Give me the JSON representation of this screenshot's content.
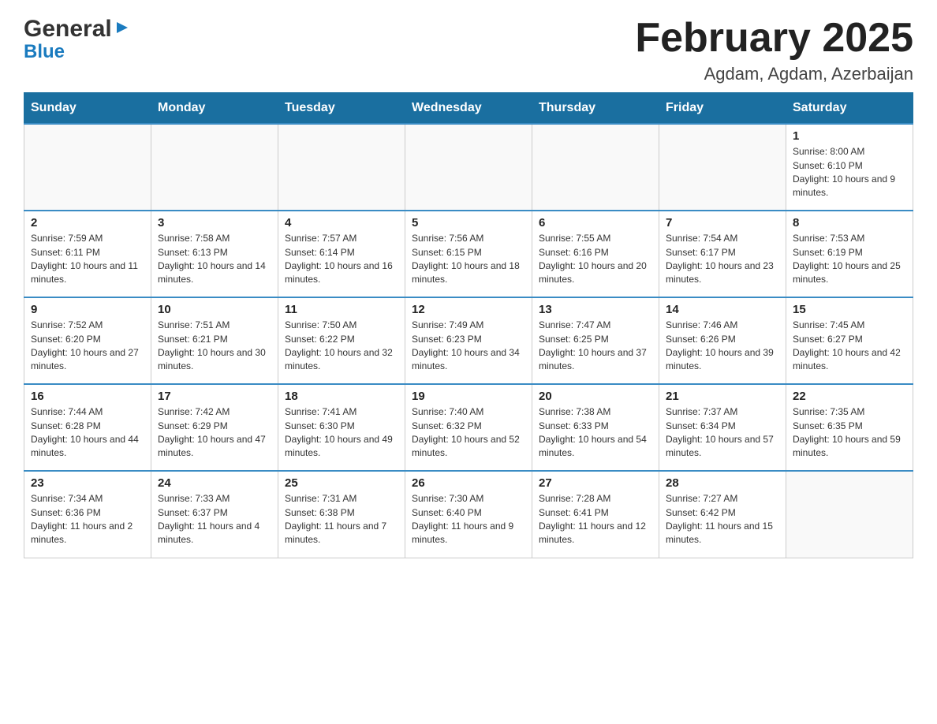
{
  "header": {
    "logo_name": "General",
    "logo_name2": "Blue",
    "title": "February 2025",
    "subtitle": "Agdam, Agdam, Azerbaijan"
  },
  "days_of_week": [
    "Sunday",
    "Monday",
    "Tuesday",
    "Wednesday",
    "Thursday",
    "Friday",
    "Saturday"
  ],
  "weeks": [
    [
      {
        "day": "",
        "info": ""
      },
      {
        "day": "",
        "info": ""
      },
      {
        "day": "",
        "info": ""
      },
      {
        "day": "",
        "info": ""
      },
      {
        "day": "",
        "info": ""
      },
      {
        "day": "",
        "info": ""
      },
      {
        "day": "1",
        "info": "Sunrise: 8:00 AM\nSunset: 6:10 PM\nDaylight: 10 hours and 9 minutes."
      }
    ],
    [
      {
        "day": "2",
        "info": "Sunrise: 7:59 AM\nSunset: 6:11 PM\nDaylight: 10 hours and 11 minutes."
      },
      {
        "day": "3",
        "info": "Sunrise: 7:58 AM\nSunset: 6:13 PM\nDaylight: 10 hours and 14 minutes."
      },
      {
        "day": "4",
        "info": "Sunrise: 7:57 AM\nSunset: 6:14 PM\nDaylight: 10 hours and 16 minutes."
      },
      {
        "day": "5",
        "info": "Sunrise: 7:56 AM\nSunset: 6:15 PM\nDaylight: 10 hours and 18 minutes."
      },
      {
        "day": "6",
        "info": "Sunrise: 7:55 AM\nSunset: 6:16 PM\nDaylight: 10 hours and 20 minutes."
      },
      {
        "day": "7",
        "info": "Sunrise: 7:54 AM\nSunset: 6:17 PM\nDaylight: 10 hours and 23 minutes."
      },
      {
        "day": "8",
        "info": "Sunrise: 7:53 AM\nSunset: 6:19 PM\nDaylight: 10 hours and 25 minutes."
      }
    ],
    [
      {
        "day": "9",
        "info": "Sunrise: 7:52 AM\nSunset: 6:20 PM\nDaylight: 10 hours and 27 minutes."
      },
      {
        "day": "10",
        "info": "Sunrise: 7:51 AM\nSunset: 6:21 PM\nDaylight: 10 hours and 30 minutes."
      },
      {
        "day": "11",
        "info": "Sunrise: 7:50 AM\nSunset: 6:22 PM\nDaylight: 10 hours and 32 minutes."
      },
      {
        "day": "12",
        "info": "Sunrise: 7:49 AM\nSunset: 6:23 PM\nDaylight: 10 hours and 34 minutes."
      },
      {
        "day": "13",
        "info": "Sunrise: 7:47 AM\nSunset: 6:25 PM\nDaylight: 10 hours and 37 minutes."
      },
      {
        "day": "14",
        "info": "Sunrise: 7:46 AM\nSunset: 6:26 PM\nDaylight: 10 hours and 39 minutes."
      },
      {
        "day": "15",
        "info": "Sunrise: 7:45 AM\nSunset: 6:27 PM\nDaylight: 10 hours and 42 minutes."
      }
    ],
    [
      {
        "day": "16",
        "info": "Sunrise: 7:44 AM\nSunset: 6:28 PM\nDaylight: 10 hours and 44 minutes."
      },
      {
        "day": "17",
        "info": "Sunrise: 7:42 AM\nSunset: 6:29 PM\nDaylight: 10 hours and 47 minutes."
      },
      {
        "day": "18",
        "info": "Sunrise: 7:41 AM\nSunset: 6:30 PM\nDaylight: 10 hours and 49 minutes."
      },
      {
        "day": "19",
        "info": "Sunrise: 7:40 AM\nSunset: 6:32 PM\nDaylight: 10 hours and 52 minutes."
      },
      {
        "day": "20",
        "info": "Sunrise: 7:38 AM\nSunset: 6:33 PM\nDaylight: 10 hours and 54 minutes."
      },
      {
        "day": "21",
        "info": "Sunrise: 7:37 AM\nSunset: 6:34 PM\nDaylight: 10 hours and 57 minutes."
      },
      {
        "day": "22",
        "info": "Sunrise: 7:35 AM\nSunset: 6:35 PM\nDaylight: 10 hours and 59 minutes."
      }
    ],
    [
      {
        "day": "23",
        "info": "Sunrise: 7:34 AM\nSunset: 6:36 PM\nDaylight: 11 hours and 2 minutes."
      },
      {
        "day": "24",
        "info": "Sunrise: 7:33 AM\nSunset: 6:37 PM\nDaylight: 11 hours and 4 minutes."
      },
      {
        "day": "25",
        "info": "Sunrise: 7:31 AM\nSunset: 6:38 PM\nDaylight: 11 hours and 7 minutes."
      },
      {
        "day": "26",
        "info": "Sunrise: 7:30 AM\nSunset: 6:40 PM\nDaylight: 11 hours and 9 minutes."
      },
      {
        "day": "27",
        "info": "Sunrise: 7:28 AM\nSunset: 6:41 PM\nDaylight: 11 hours and 12 minutes."
      },
      {
        "day": "28",
        "info": "Sunrise: 7:27 AM\nSunset: 6:42 PM\nDaylight: 11 hours and 15 minutes."
      },
      {
        "day": "",
        "info": ""
      }
    ]
  ]
}
